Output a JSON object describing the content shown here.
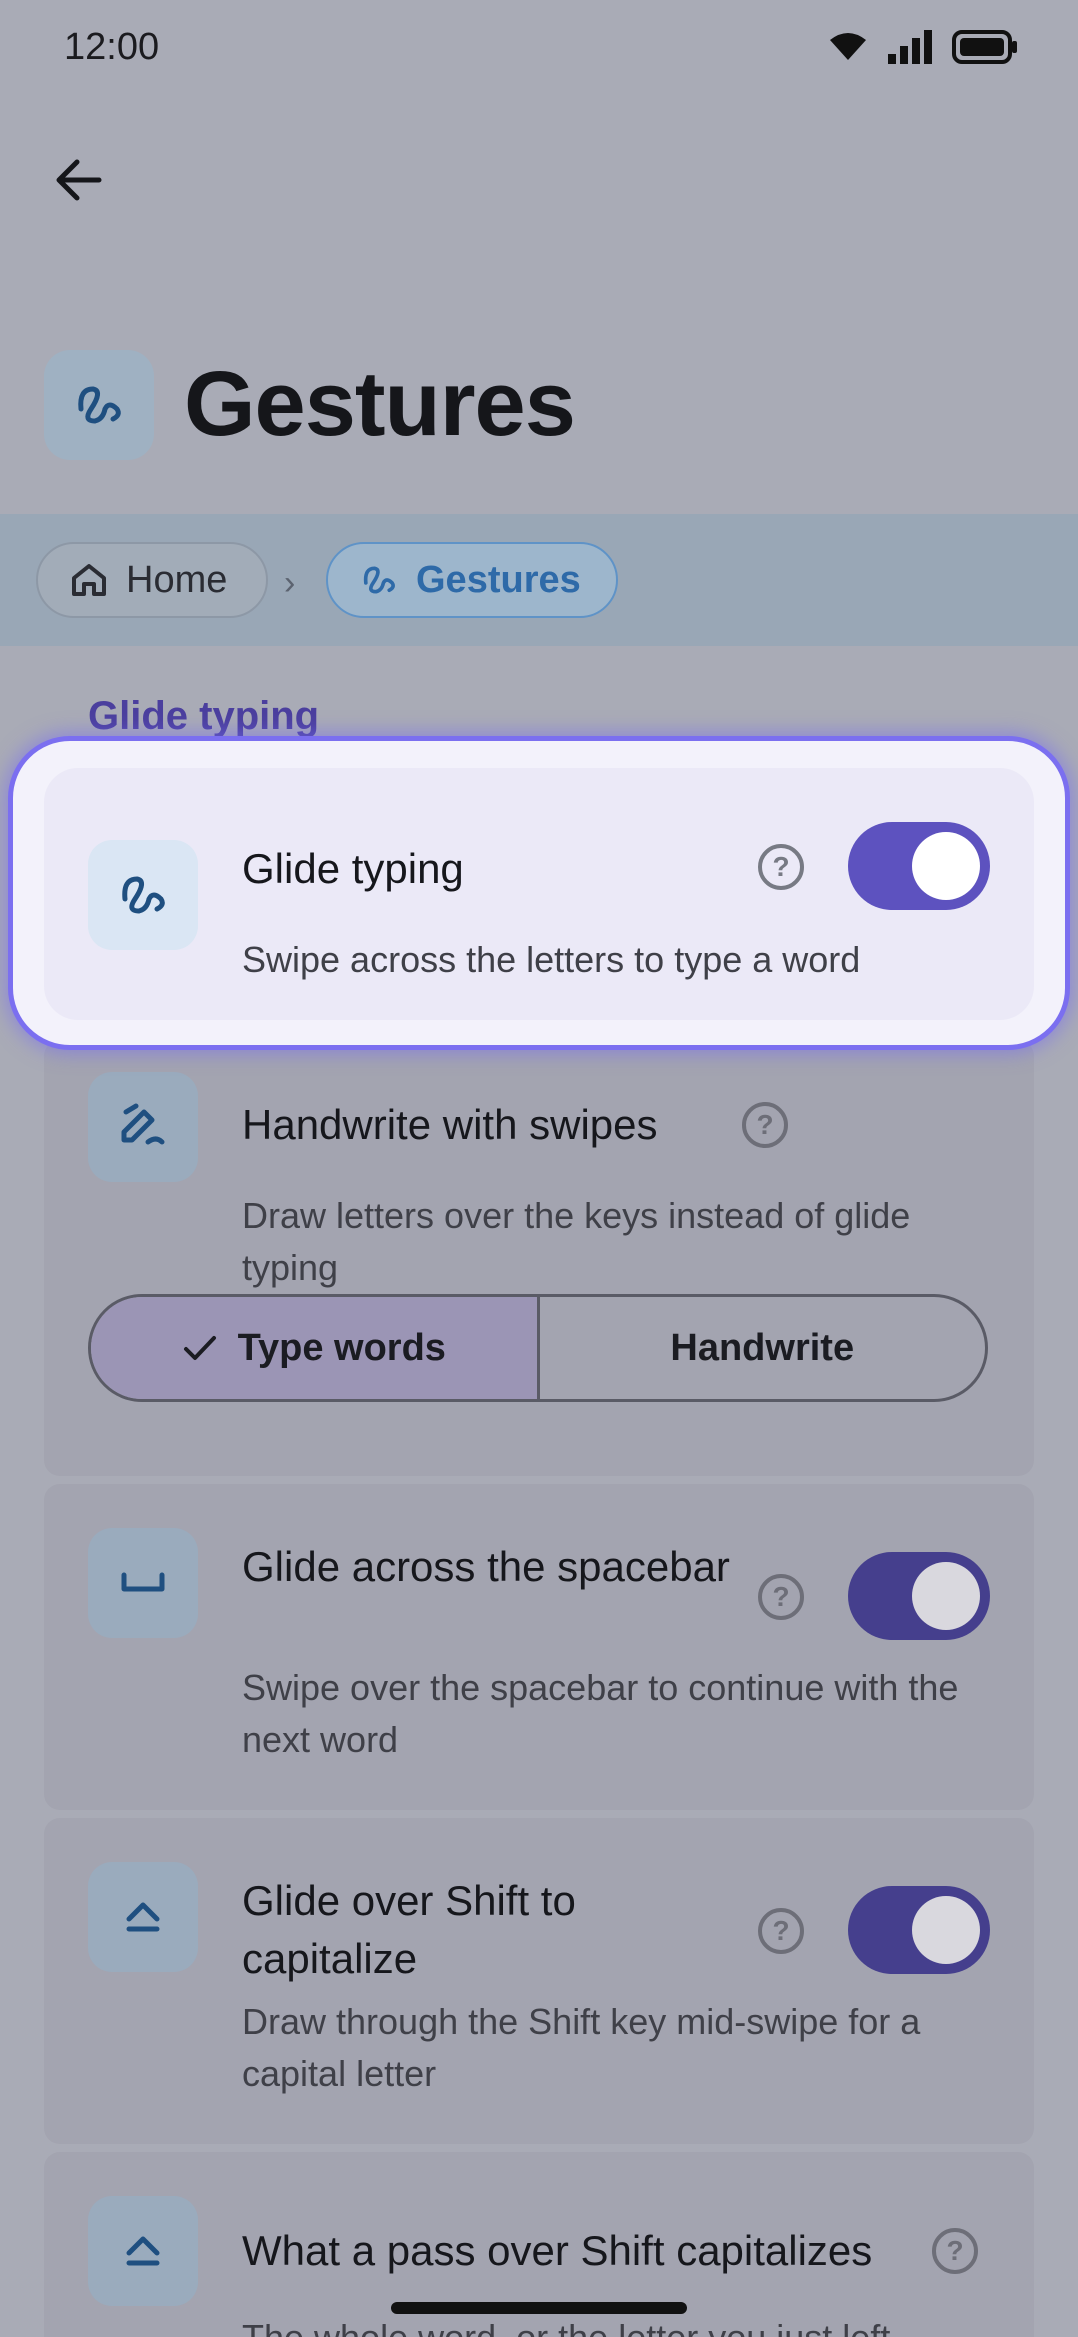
{
  "status": {
    "time": "12:00"
  },
  "header": {
    "title": "Gestures"
  },
  "breadcrumb": {
    "home": "Home",
    "current": "Gestures"
  },
  "section": {
    "label": "Glide typing"
  },
  "settings": [
    {
      "title": "Glide typing",
      "description": "Swipe across the letters to type a word",
      "enabled": true
    },
    {
      "title": "Handwrite with swipes",
      "description": "Draw letters over the keys instead of glide typing",
      "options": [
        "Type words",
        "Handwrite"
      ],
      "selected": "Type words"
    },
    {
      "title": "Glide across the spacebar",
      "description": "Swipe over the spacebar to continue with the next word",
      "enabled": true
    },
    {
      "title": "Glide over Shift to capitalize",
      "description": "Draw through the Shift key mid-swipe for a capital letter",
      "enabled": true
    },
    {
      "title": "What a pass over Shift capitalizes",
      "description": "The whole word, or the letter you just left"
    }
  ],
  "colors": {
    "accent": "#5d52bf",
    "toggle_dim": "#453f8d",
    "link": "#2e6aa8"
  },
  "icons": [
    "back-arrow-icon",
    "glide-squiggle-icon",
    "home-icon",
    "chevron-right-icon",
    "handwrite-pen-icon",
    "spacebar-icon",
    "shift-icon",
    "help-icon",
    "check-icon",
    "wifi-icon",
    "signal-icon",
    "battery-icon"
  ]
}
